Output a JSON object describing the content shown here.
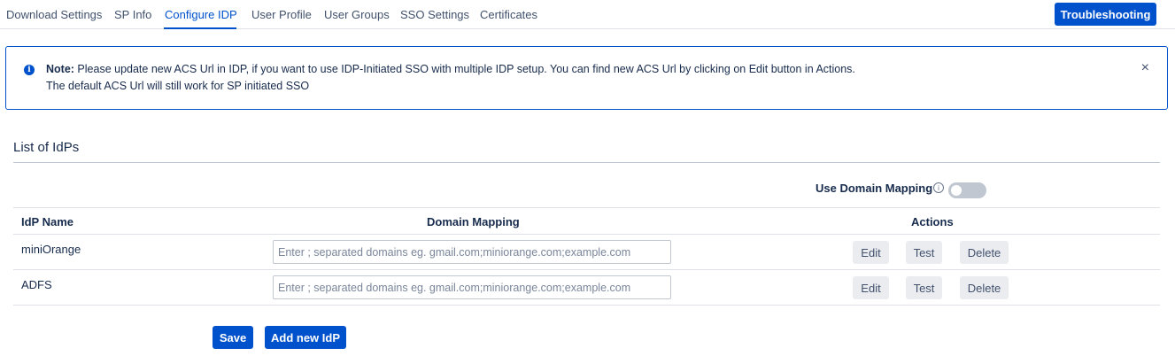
{
  "tabs": [
    "Download Settings",
    "SP Info",
    "Configure IDP",
    "User Profile",
    "User Groups",
    "SSO Settings",
    "Certificates"
  ],
  "active_tab": "Configure IDP",
  "troubleshooting_label": "Troubleshooting",
  "note": {
    "label": "Note:",
    "text": " Please update new ACS Url in IDP, if you want to use IDP-Initiated SSO with multiple IDP setup. You can find new ACS Url by clicking on Edit button in Actions.",
    "line2": "The default ACS Url will still work for SP initiated SSO",
    "close_icon": "×",
    "info_icon": "i"
  },
  "section_title": "List of IdPs",
  "domain_mapping_toggle": {
    "label": "Use Domain Mapping",
    "info_icon": "i",
    "enabled": false
  },
  "table": {
    "headers": {
      "name": "IdP Name",
      "domain": "Domain Mapping",
      "actions": "Actions"
    },
    "rows": [
      {
        "name": "miniOrange",
        "domain_value": "",
        "domain_placeholder": "Enter ; separated domains eg. gmail.com;miniorange.com;example.com",
        "edit": "Edit",
        "test": "Test",
        "delete": "Delete"
      },
      {
        "name": "ADFS",
        "domain_value": "",
        "domain_placeholder": "Enter ; separated domains eg. gmail.com;miniorange.com;example.com",
        "edit": "Edit",
        "test": "Test",
        "delete": "Delete"
      }
    ]
  },
  "save_label": "Save",
  "add_idp_label": "Add new IdP",
  "colors": {
    "primary": "#0052cc",
    "secondary_button": "#ebecf0",
    "toggle_off": "#c1c7d0"
  }
}
